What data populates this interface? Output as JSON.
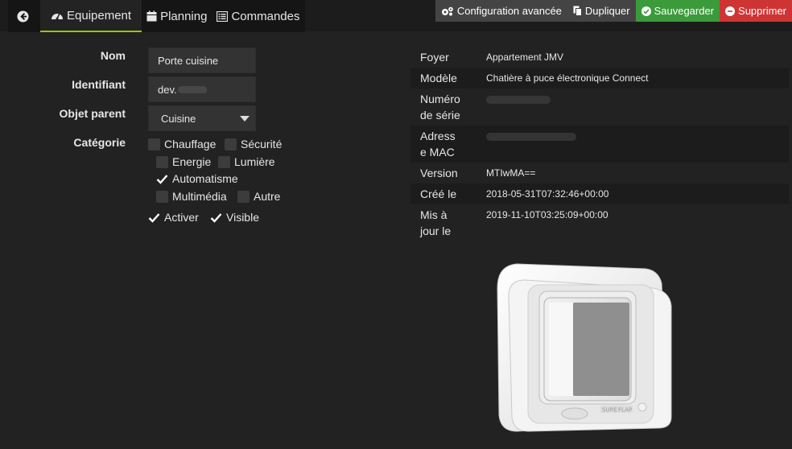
{
  "tabs": [
    {
      "label": "Equipement",
      "icon": "dashboard-icon",
      "active": true
    },
    {
      "label": "Planning",
      "icon": "calendar-icon"
    },
    {
      "label": "Commandes",
      "icon": "list-icon"
    }
  ],
  "actions": {
    "config": "Configuration avancée",
    "duplicate": "Dupliquer",
    "save": "Sauvegarder",
    "delete": "Supprimer"
  },
  "form": {
    "nom_label": "Nom",
    "nom_value": "Porte cuisine",
    "id_label": "Identifiant",
    "id_value": "dev.",
    "parent_label": "Objet parent",
    "parent_value": "Cuisine",
    "categorie_label": "Catégorie",
    "categories": [
      {
        "label": "Chauffage",
        "checked": false
      },
      {
        "label": "Sécurité",
        "checked": false
      },
      {
        "label": "Energie",
        "checked": false
      },
      {
        "label": "Lumière",
        "checked": false
      },
      {
        "label": "Automatisme",
        "checked": true
      },
      {
        "label": "Multimédia",
        "checked": false
      },
      {
        "label": "Autre",
        "checked": false
      }
    ],
    "activer": "Activer",
    "visible": "Visible"
  },
  "info": {
    "foyer_k": "Foyer",
    "foyer_v": "Appartement JMV",
    "modele_k": "Modèle",
    "modele_v": "Chatière à puce électronique Connect",
    "serie_k1": "Numéro",
    "serie_k2": "de série",
    "mac_k1": "Adress",
    "mac_k2": "e MAC",
    "version_k": "Version",
    "version_v": "MTIwMA==",
    "cree_k": "Créé le",
    "cree_v": "2018-05-31T07:32:46+00:00",
    "maj_k1": "Mis à",
    "maj_k2": "jour le",
    "maj_v": "2019-11-10T03:25:09+00:00"
  },
  "device": {
    "brand": "SURE",
    "brand2": "FLAP"
  },
  "colors": {
    "accent": "#94ca02",
    "save": "#3b9b3b",
    "delete": "#cf3434"
  }
}
